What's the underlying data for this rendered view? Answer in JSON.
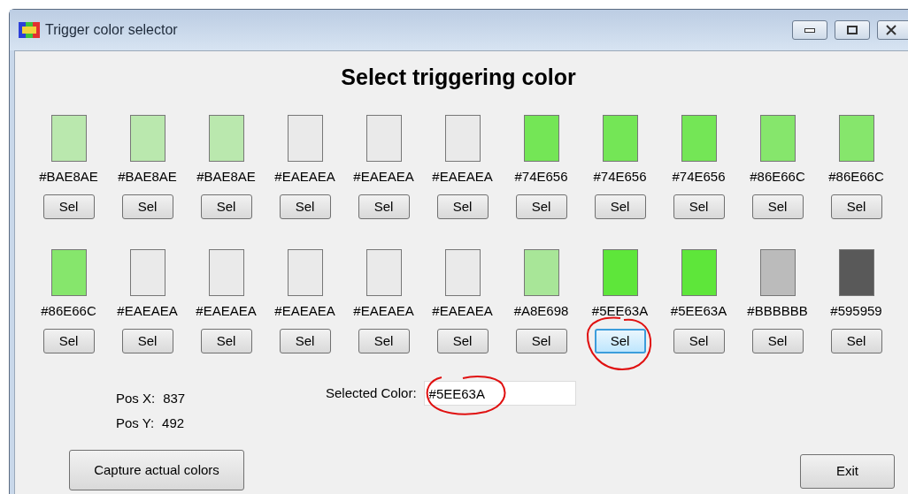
{
  "window": {
    "title": "Trigger color selector"
  },
  "heading": "Select triggering color",
  "swatch_rows": [
    [
      {
        "hex": "#BAE8AE",
        "color": "#bae8ae",
        "button": "Sel",
        "selected": false
      },
      {
        "hex": "#BAE8AE",
        "color": "#bae8ae",
        "button": "Sel",
        "selected": false
      },
      {
        "hex": "#BAE8AE",
        "color": "#bae8ae",
        "button": "Sel",
        "selected": false
      },
      {
        "hex": "#EAEAEA",
        "color": "#eaeaea",
        "button": "Sel",
        "selected": false
      },
      {
        "hex": "#EAEAEA",
        "color": "#eaeaea",
        "button": "Sel",
        "selected": false
      },
      {
        "hex": "#EAEAEA",
        "color": "#eaeaea",
        "button": "Sel",
        "selected": false
      },
      {
        "hex": "#74E656",
        "color": "#74e656",
        "button": "Sel",
        "selected": false
      },
      {
        "hex": "#74E656",
        "color": "#74e656",
        "button": "Sel",
        "selected": false
      },
      {
        "hex": "#74E656",
        "color": "#74e656",
        "button": "Sel",
        "selected": false
      },
      {
        "hex": "#86E66C",
        "color": "#86e66c",
        "button": "Sel",
        "selected": false
      },
      {
        "hex": "#86E66C",
        "color": "#86e66c",
        "button": "Sel",
        "selected": false
      }
    ],
    [
      {
        "hex": "#86E66C",
        "color": "#86e66c",
        "button": "Sel",
        "selected": false
      },
      {
        "hex": "#EAEAEA",
        "color": "#eaeaea",
        "button": "Sel",
        "selected": false
      },
      {
        "hex": "#EAEAEA",
        "color": "#eaeaea",
        "button": "Sel",
        "selected": false
      },
      {
        "hex": "#EAEAEA",
        "color": "#eaeaea",
        "button": "Sel",
        "selected": false
      },
      {
        "hex": "#EAEAEA",
        "color": "#eaeaea",
        "button": "Sel",
        "selected": false
      },
      {
        "hex": "#EAEAEA",
        "color": "#eaeaea",
        "button": "Sel",
        "selected": false
      },
      {
        "hex": "#A8E698",
        "color": "#a8e698",
        "button": "Sel",
        "selected": false
      },
      {
        "hex": "#5EE63A",
        "color": "#5ee63a",
        "button": "Sel",
        "selected": true
      },
      {
        "hex": "#5EE63A",
        "color": "#5ee63a",
        "button": "Sel",
        "selected": false
      },
      {
        "hex": "#BBBBBB",
        "color": "#bbbbbb",
        "button": "Sel",
        "selected": false
      },
      {
        "hex": "#595959",
        "color": "#595959",
        "button": "Sel",
        "selected": false
      }
    ]
  ],
  "position": {
    "x_label": "Pos X:",
    "x_value": "837",
    "y_label": "Pos Y:",
    "y_value": "492"
  },
  "selected_color": {
    "label": "Selected Color:",
    "value": "#5EE63A"
  },
  "buttons": [
    {
      "label": "Capture actual colors"
    },
    {
      "label": "Exit"
    }
  ]
}
